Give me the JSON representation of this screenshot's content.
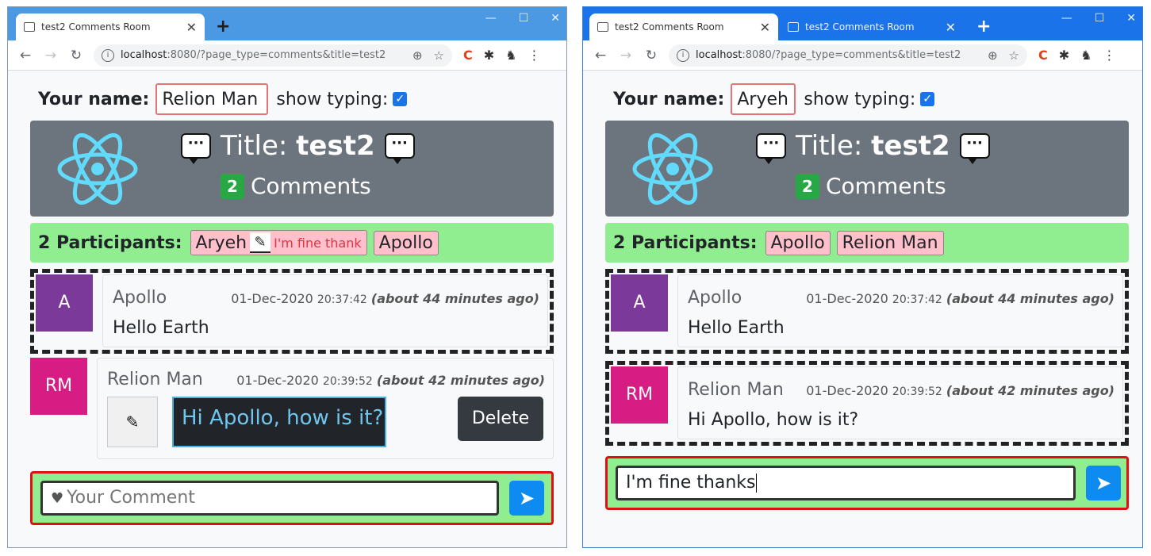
{
  "left": {
    "tabs": [
      {
        "title": "test2 Comments Room",
        "active": true
      }
    ],
    "url_host": "localhost",
    "url_rest": ":8080/?page_type=comments&title=test2",
    "your_name_label": "Your name:",
    "your_name_value": "Relion Man",
    "show_typing_label": "show typing:",
    "title_prefix": "Title:",
    "title_value": "test2",
    "comment_count": "2",
    "comments_label": "Comments",
    "participants_label": "2 Participants:",
    "participants": [
      {
        "name": "Aryeh",
        "typing": "I'm fine thank"
      },
      {
        "name": "Apollo"
      }
    ],
    "comments": [
      {
        "initials": "A",
        "author": "Apollo",
        "date": "01-Dec-2020",
        "time": "20:37:42",
        "ago": "(about 44 minutes ago)",
        "text": "Hello Earth",
        "avatar_color": "#7b3a9a"
      },
      {
        "initials": "RM",
        "author": "Relion Man",
        "date": "01-Dec-2020",
        "time": "20:39:52",
        "ago": "(about 42 minutes ago)",
        "text": "Hi Apollo, how is it?",
        "avatar_color": "#d71c84"
      }
    ],
    "edit_icon": "pencil-icon",
    "delete_label": "Delete",
    "compose_placeholder": "Your Comment",
    "send_icon": "send-icon"
  },
  "right": {
    "tabs": [
      {
        "title": "test2 Comments Room",
        "active": true
      },
      {
        "title": "test2 Comments Room",
        "active": false
      }
    ],
    "url_host": "localhost",
    "url_rest": ":8080/?page_type=comments&title=test2",
    "your_name_label": "Your name:",
    "your_name_value": "Aryeh",
    "show_typing_label": "show typing:",
    "title_prefix": "Title:",
    "title_value": "test2",
    "comment_count": "2",
    "comments_label": "Comments",
    "participants_label": "2 Participants:",
    "participants": [
      {
        "name": "Apollo"
      },
      {
        "name": "Relion Man"
      }
    ],
    "comments": [
      {
        "initials": "A",
        "author": "Apollo",
        "date": "01-Dec-2020",
        "time": "20:37:42",
        "ago": "(about 44 minutes ago)",
        "text": "Hello Earth",
        "avatar_color": "#7b3a9a"
      },
      {
        "initials": "RM",
        "author": "Relion Man",
        "date": "01-Dec-2020",
        "time": "20:39:52",
        "ago": "(about 42 minutes ago)",
        "text": "Hi Apollo, how is it?",
        "avatar_color": "#d71c84"
      }
    ],
    "compose_value": "I'm fine thanks",
    "send_icon": "send-icon"
  },
  "colors": {
    "header_bg": "#6c757d",
    "participants_bg": "#90ee90",
    "badge_green": "#28a745",
    "participant_pill": "#ffc0cb",
    "send_blue": "#0d8bf0"
  }
}
